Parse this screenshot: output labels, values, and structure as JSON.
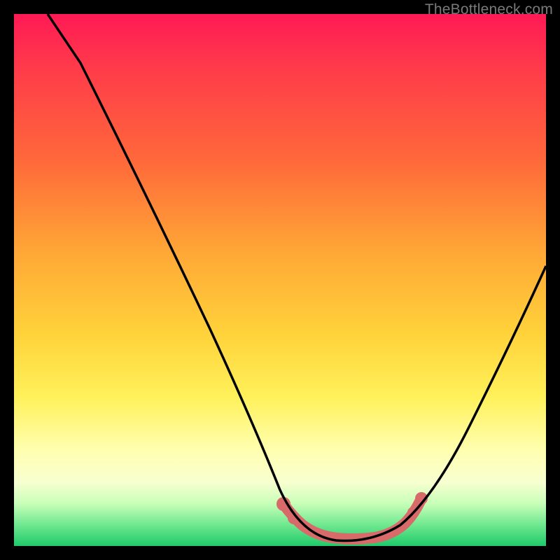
{
  "watermark": "TheBottleneck.com",
  "chart_data": {
    "type": "line",
    "title": "",
    "xlabel": "",
    "ylabel": "",
    "ylim": [
      0,
      100
    ],
    "series": [
      {
        "name": "bottleneck-curve",
        "x": [
          0.0,
          0.06,
          0.12,
          0.18,
          0.24,
          0.3,
          0.36,
          0.42,
          0.48,
          0.52,
          0.56,
          0.6,
          0.64,
          0.68,
          0.72,
          0.76,
          0.8,
          0.86,
          0.92,
          1.0
        ],
        "values": [
          100,
          90,
          80,
          70,
          58,
          46,
          34,
          22,
          10,
          5,
          2,
          1,
          1,
          2,
          5,
          10,
          18,
          28,
          40,
          55
        ]
      },
      {
        "name": "optimal-region",
        "x": [
          0.5,
          0.52,
          0.55,
          0.58,
          0.61,
          0.64,
          0.67,
          0.7,
          0.73,
          0.76
        ],
        "values": [
          6,
          4,
          2,
          1,
          1,
          1,
          2,
          3,
          6,
          10
        ]
      }
    ],
    "background_gradient": {
      "stops": [
        {
          "pos": 0.0,
          "color": "#ff1a55"
        },
        {
          "pos": 0.28,
          "color": "#ff6a3a"
        },
        {
          "pos": 0.6,
          "color": "#ffd23a"
        },
        {
          "pos": 0.82,
          "color": "#ffffb0"
        },
        {
          "pos": 0.96,
          "color": "#70e890"
        },
        {
          "pos": 1.0,
          "color": "#1fc96a"
        }
      ]
    },
    "highlight_color": "#d96a6a",
    "curve_color": "#000000"
  }
}
